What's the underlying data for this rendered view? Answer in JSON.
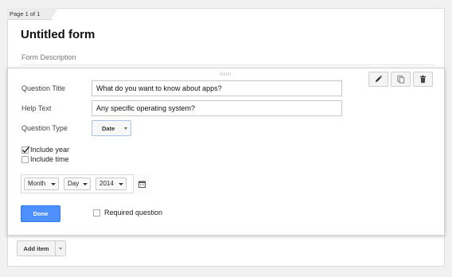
{
  "page": {
    "indicator": "Page 1 of 1"
  },
  "form": {
    "title": "Untitled form",
    "description_placeholder": "Form Description"
  },
  "toolbar": {
    "edit_icon": "pencil-icon",
    "duplicate_icon": "duplicate-icon",
    "delete_icon": "trash-icon"
  },
  "question": {
    "title_label": "Question Title",
    "title_value": "What do you want to know about apps?",
    "help_label": "Help Text",
    "help_value": "Any specific operating system?",
    "type_label": "Question Type",
    "type_value": "Date"
  },
  "options": {
    "include_year": {
      "label": "Include year",
      "checked": true
    },
    "include_time": {
      "label": "Include time",
      "checked": false
    }
  },
  "date_preview": {
    "month": "Month",
    "day": "Day",
    "year": "2014",
    "calendar_icon": "calendar-icon"
  },
  "actions": {
    "done": "Done",
    "required_label": "Required question",
    "required_checked": false,
    "add_item": "Add item"
  },
  "colors": {
    "accent": "#4d90fe",
    "select_border": "#a9c3ea"
  }
}
